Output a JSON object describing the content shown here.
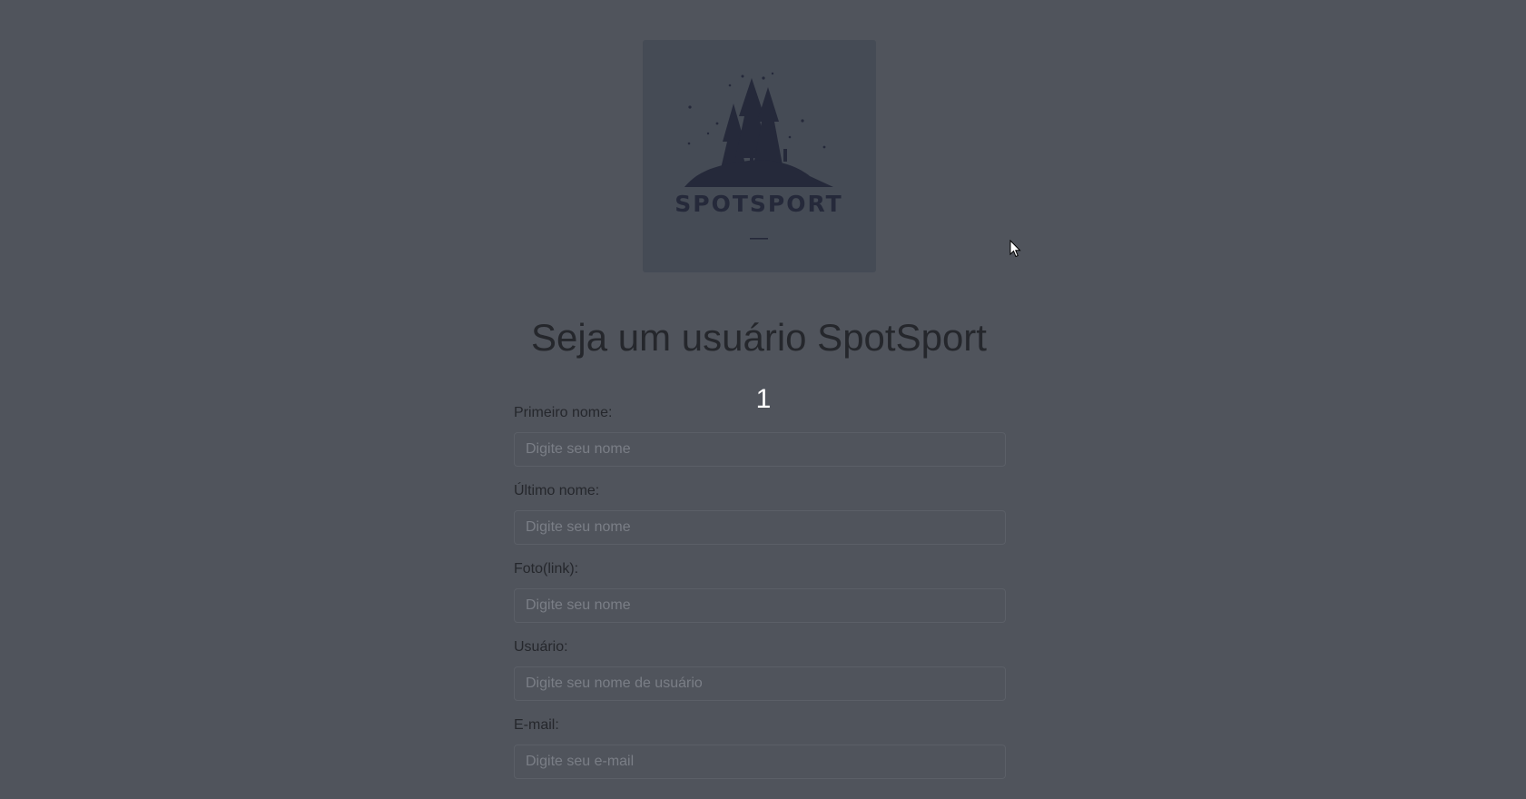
{
  "logo": {
    "brand_text": "SPOTSPORT",
    "icon": "forest-island-logo"
  },
  "page_title": "Seja um usuário SpotSport",
  "step_number": "1",
  "fields": [
    {
      "label": "Primeiro nome:",
      "placeholder": "Digite seu nome",
      "value": ""
    },
    {
      "label": "Último nome:",
      "placeholder": "Digite seu nome",
      "value": ""
    },
    {
      "label": "Foto(link):",
      "placeholder": "Digite seu nome",
      "value": ""
    },
    {
      "label": "Usuário:",
      "placeholder": "Digite seu nome de usuário",
      "value": ""
    },
    {
      "label": "E-mail:",
      "placeholder": "Digite seu e-mail",
      "value": ""
    }
  ],
  "colors": {
    "background": "#50545c",
    "logo_background": "#454b55",
    "title": "#25272c",
    "step_number": "#ffffff"
  },
  "cursor_icon": "mouse-pointer-icon"
}
